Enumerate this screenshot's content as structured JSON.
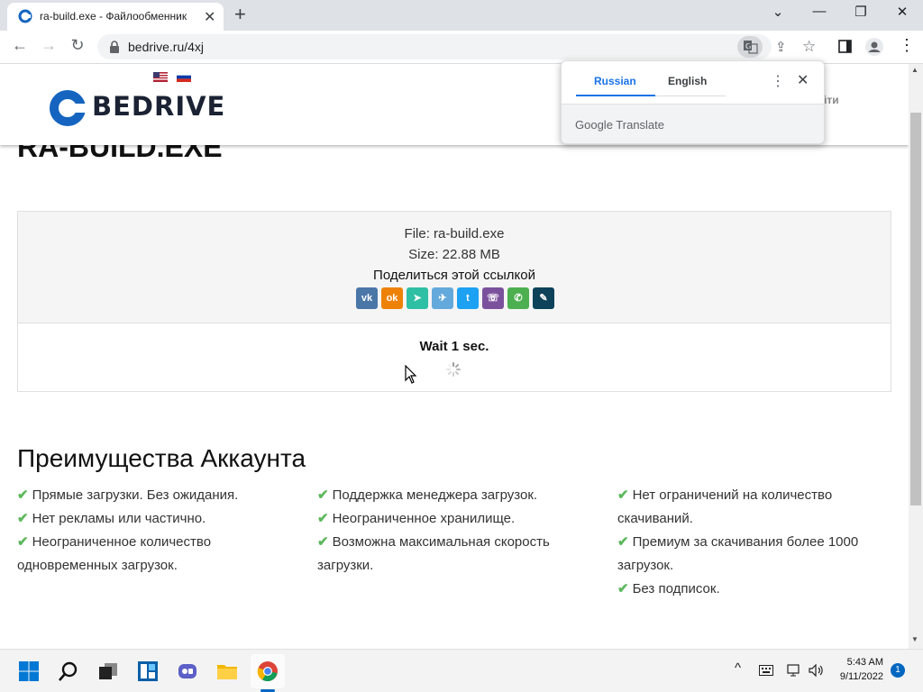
{
  "browser": {
    "tab_title": "ra-build.exe - Файлообменник",
    "tab_close": "✕",
    "new_tab": "+",
    "url": "bedrive.ru/4xj",
    "window_controls": {
      "minimize": "—",
      "maximize": "❐",
      "close": "✕",
      "tab_search": "⌄"
    },
    "nav": {
      "back": "←",
      "forward": "→",
      "reload": "↻"
    }
  },
  "site": {
    "logo_text": "BEDRIVE",
    "flags": [
      "us-flag",
      "ru-flag"
    ],
    "login_partial": "йти"
  },
  "file": {
    "title": "RA-BUILD.EXE",
    "name_line": "File: ra-build.exe",
    "size_line": "Size: 22.88 MB",
    "share_label": "Поделиться этой ссылкой",
    "share_buttons": [
      {
        "name": "vk",
        "glyph": "vk",
        "color": "#4a76a8"
      },
      {
        "name": "odnoklassniki",
        "glyph": "ok",
        "color": "#ee8208"
      },
      {
        "name": "yandex-message",
        "glyph": "➤",
        "color": "#2ebfa5"
      },
      {
        "name": "telegram",
        "glyph": "✈",
        "color": "#64a9dc"
      },
      {
        "name": "twitter",
        "glyph": "t",
        "color": "#1da1f2"
      },
      {
        "name": "viber",
        "glyph": "☏",
        "color": "#7b519d"
      },
      {
        "name": "whatsapp",
        "glyph": "✆",
        "color": "#4caf50"
      },
      {
        "name": "livejournal",
        "glyph": "✎",
        "color": "#0d425a"
      }
    ],
    "wait_text": "Wait 1 sec."
  },
  "advantages": {
    "title": "Преимущества Аккаунта",
    "col1": [
      "Прямые загрузки. Без ожидания.",
      "Нет рекламы или частично.",
      "Неограниченное количество одновременных загрузок."
    ],
    "col2": [
      "Поддержка менеджера загрузок.",
      "Неограниченное хранилище.",
      "Возможна максимальная скорость загрузки."
    ],
    "col3": [
      "Нет ограничений на количество скачиваний.",
      "Премиум за скачивания более 1000 загрузок.",
      "Без подписок."
    ],
    "check_glyph": "✔",
    "check_color": "#5cb85c"
  },
  "translate_popup": {
    "tab_source": "Russian",
    "tab_target": "English",
    "menu": "⋮",
    "close": "✕",
    "footer": "Google Translate",
    "accent": "#1a73e8"
  },
  "taskbar": {
    "time": "5:43 AM",
    "date": "9/11/2022",
    "notification_count": "1",
    "tray_chevron": "^",
    "apps": [
      "windows-start-icon",
      "search-icon",
      "task-view-icon",
      "widgets-icon",
      "teams-chat-icon",
      "file-explorer-icon",
      "chrome-icon"
    ]
  }
}
